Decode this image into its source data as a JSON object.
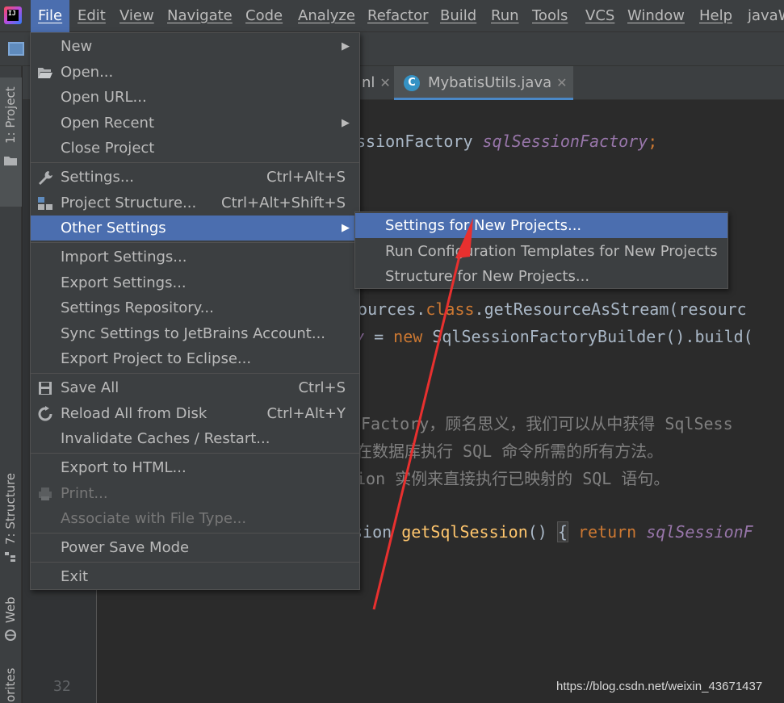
{
  "menubar": {
    "items": [
      "File",
      "Edit",
      "View",
      "Navigate",
      "Code",
      "Analyze",
      "Refactor",
      "Build",
      "Run",
      "Tools",
      "VCS",
      "Window",
      "Help"
    ],
    "project_name": "javaW"
  },
  "stripe": {
    "project_tab": "1: Project",
    "structure_tab": "7: Structure",
    "web_tab": "Web",
    "favorites_tab": "orites"
  },
  "tabs": {
    "prev_tab_fragment": "nl",
    "active_tab": "MybatisUtils.java",
    "active_tab_icon": "C"
  },
  "gutter": {
    "line_number": "32"
  },
  "code": {
    "line1_a": "ssionFactory ",
    "line1_field": "sqlSessionFactory",
    "line1_end": ";",
    "line2_a": "sources.",
    "line2_kw": "class",
    "line2_b": ".getResourceAsStream(resourc",
    "line3_field": "y",
    "line3_a": " = ",
    "line3_kw": "new",
    "line3_b": " SqlSessionFactoryBuilder().build(",
    "comment1": "Factory，顾名思义，我们可以从中获得 SqlSess",
    "comment2": "在数据库执行 SQL 命令所需的所有方法。",
    "comment3": "ion 实例来直接执行已映射的 SQL 语句。",
    "line4_a": "sion ",
    "line4_fn": "getSqlSession",
    "line4_b": "() ",
    "line4_brace": "{",
    "line4_kw": " return ",
    "line4_field": "sqlSessionF"
  },
  "file_menu": {
    "new": "New",
    "open": "Open...",
    "open_url": "Open URL...",
    "open_recent": "Open Recent",
    "close_project": "Close Project",
    "settings": "Settings...",
    "settings_shortcut": "Ctrl+Alt+S",
    "project_structure": "Project Structure...",
    "project_structure_shortcut": "Ctrl+Alt+Shift+S",
    "other_settings": "Other Settings",
    "import_settings": "Import Settings...",
    "export_settings": "Export Settings...",
    "settings_repository": "Settings Repository...",
    "sync_settings": "Sync Settings to JetBrains Account...",
    "export_eclipse": "Export Project to Eclipse...",
    "save_all": "Save All",
    "save_all_shortcut": "Ctrl+S",
    "reload_disk": "Reload All from Disk",
    "reload_disk_shortcut": "Ctrl+Alt+Y",
    "invalidate_caches": "Invalidate Caches / Restart...",
    "export_html": "Export to HTML...",
    "print": "Print...",
    "associate_file_type": "Associate with File Type...",
    "power_save": "Power Save Mode",
    "exit": "Exit"
  },
  "other_settings_submenu": {
    "settings_new_projects": "Settings for New Projects...",
    "run_config_templates": "Run Configuration Templates for New Projects",
    "structure_new_projects": "Structure for New Projects..."
  },
  "watermark": "https://blog.csdn.net/weixin_43671437",
  "colors": {
    "highlight": "#4b6eaf",
    "menu_bg": "#3c3f41",
    "editor_bg": "#2b2b2b",
    "annotation_arrow": "#e8302f"
  }
}
